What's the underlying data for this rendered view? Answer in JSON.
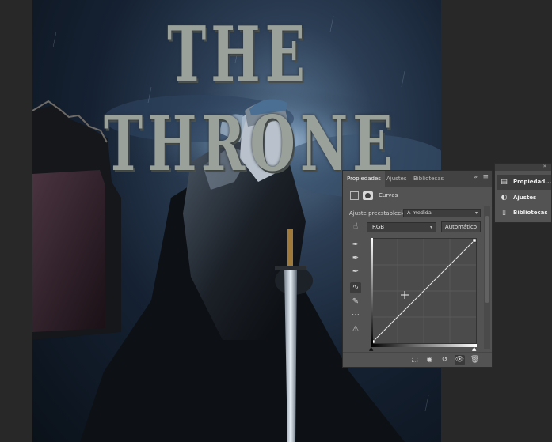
{
  "artwork": {
    "title": "THE THRONE"
  },
  "properties_panel": {
    "tabs": [
      {
        "label": "Propiedades",
        "active": true
      },
      {
        "label": "Ajustes",
        "active": false
      },
      {
        "label": "Bibliotecas",
        "active": false
      }
    ],
    "collapse_glyph": "»",
    "menu_glyph": "≡",
    "layer_name": "Curvas",
    "preset_label": "Ajuste preestablecido:",
    "preset_value": "A medida",
    "channel": "RGB",
    "auto_button": "Automático",
    "tools": [
      {
        "name": "hand-adjust-icon",
        "glyph": "☝"
      },
      {
        "name": "black-eyedropper-icon",
        "glyph": "✒"
      },
      {
        "name": "gray-eyedropper-icon",
        "glyph": "✒"
      },
      {
        "name": "white-eyedropper-icon",
        "glyph": "✒"
      },
      {
        "name": "curve-points-icon",
        "glyph": "∿"
      },
      {
        "name": "pencil-icon",
        "glyph": "✎"
      },
      {
        "name": "smooth-icon",
        "glyph": "⋯"
      },
      {
        "name": "clipping-warning-icon",
        "glyph": "⚠"
      }
    ],
    "footer_icons": [
      {
        "name": "clip-to-layer-icon",
        "glyph": "⬚"
      },
      {
        "name": "view-previous-icon",
        "glyph": "◉"
      },
      {
        "name": "reset-icon",
        "glyph": "↺"
      },
      {
        "name": "visibility-icon",
        "glyph": "👁"
      },
      {
        "name": "delete-icon",
        "glyph": "🗑"
      }
    ]
  },
  "dock": {
    "collapse_glyph": "»",
    "items": [
      {
        "label": "Propiedad...",
        "icon": "properties-icon",
        "glyph": "▤",
        "active": true
      },
      {
        "label": "Ajustes",
        "icon": "adjustments-icon",
        "glyph": "◐",
        "active": false
      },
      {
        "label": "Bibliotecas",
        "icon": "libraries-icon",
        "glyph": "▯",
        "active": false
      }
    ]
  },
  "colors": {
    "workspace": "#282828",
    "panel": "#535353",
    "panel_header": "#424242"
  }
}
